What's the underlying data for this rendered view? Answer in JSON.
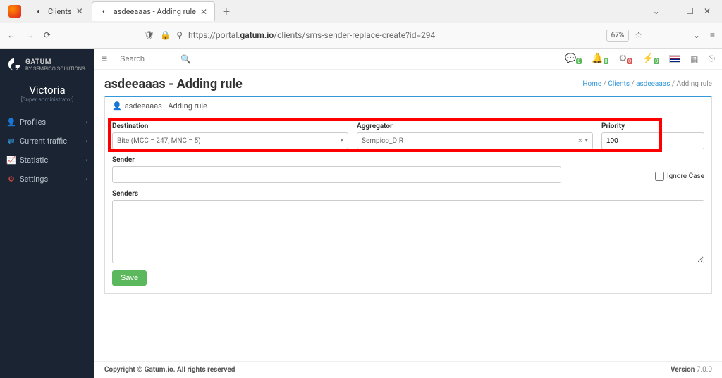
{
  "browser": {
    "tabs": [
      {
        "title": "Clients",
        "active": false
      },
      {
        "title": "asdeeaaas - Adding rule",
        "active": true
      }
    ],
    "url_prefix": "https://portal.",
    "url_host": "gatum.io",
    "url_path": "/clients/sms-sender-replace-create?id=294",
    "zoom": "67%"
  },
  "brand": {
    "name": "GATUM",
    "byline": "BY SEMPICO SOLUTIONS"
  },
  "user": {
    "name": "Victoria",
    "role": "[Super administrator]"
  },
  "sidebar": [
    {
      "icon": "👤",
      "color": "#e74c3c",
      "label": "Profiles"
    },
    {
      "icon": "⇄",
      "color": "#3498db",
      "label": "Current traffic"
    },
    {
      "icon": "📈",
      "color": "#2ecc71",
      "label": "Statistic"
    },
    {
      "icon": "⚙",
      "color": "#e74c3c",
      "label": "Settings"
    }
  ],
  "topbar": {
    "search_placeholder": "Search",
    "badges": [
      {
        "icon": "💬",
        "count": "0",
        "style": "green"
      },
      {
        "icon": "🔔",
        "count": "0",
        "style": "green"
      },
      {
        "icon": "⚙",
        "count": "0",
        "style": "red"
      },
      {
        "icon": "⚡",
        "count": "0",
        "style": "green"
      }
    ]
  },
  "page": {
    "title": "asdeeaaas - Adding rule",
    "breadcrumb": {
      "home": "Home",
      "clients": "Clients",
      "client": "asdeeaaas",
      "current": "Adding rule"
    },
    "card_title": "asdeeaaas - Adding rule"
  },
  "form": {
    "labels": {
      "destination": "Destination",
      "aggregator": "Aggregator",
      "priority": "Priority",
      "sender": "Sender",
      "ignore_case": "Ignore Case",
      "senders": "Senders",
      "save": "Save"
    },
    "values": {
      "destination": "Bite (MCC = 247, MNC = 5)",
      "aggregator": "Sempico_DIR",
      "priority": "100",
      "sender": "",
      "senders": ""
    }
  },
  "footer": {
    "copyright": "Copyright © Gatum.io. All rights reserved",
    "version_label": "Version",
    "version": "7.0.0"
  }
}
